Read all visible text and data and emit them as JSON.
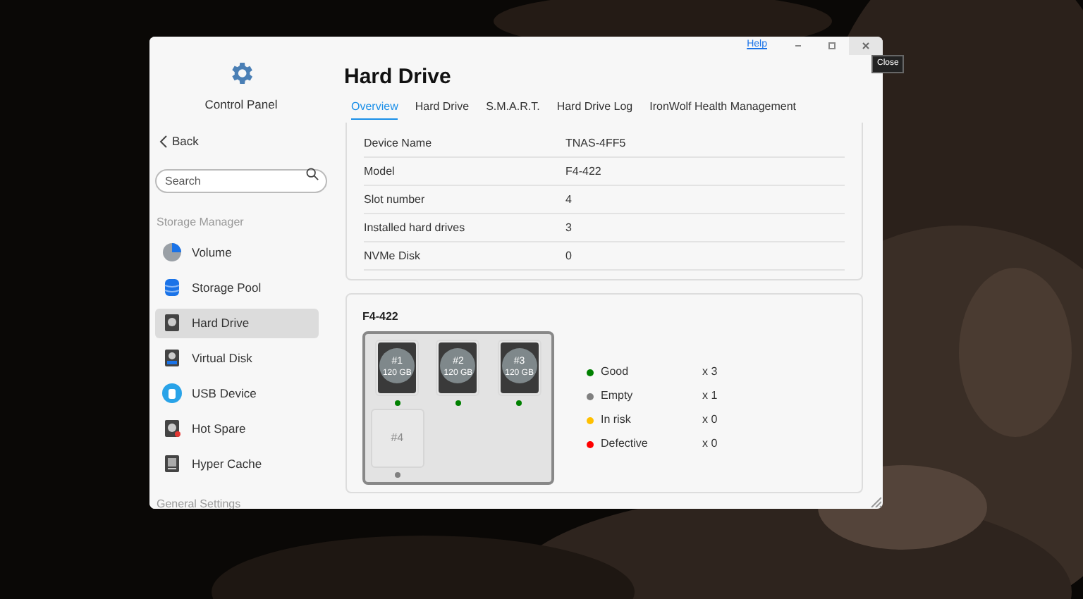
{
  "window": {
    "help": "Help",
    "tooltip": "Close"
  },
  "sidebar": {
    "title": "Control Panel",
    "back": "Back",
    "search": {
      "placeholder": "Search"
    },
    "sections": [
      {
        "heading": "Storage Manager",
        "items": [
          {
            "label": "Volume",
            "selected": false
          },
          {
            "label": "Storage Pool",
            "selected": false
          },
          {
            "label": "Hard Drive",
            "selected": true
          },
          {
            "label": "Virtual Disk",
            "selected": false
          },
          {
            "label": "USB Device",
            "selected": false
          },
          {
            "label": "Hot Spare",
            "selected": false
          },
          {
            "label": "Hyper Cache",
            "selected": false
          }
        ]
      },
      {
        "heading": "General Settings"
      }
    ]
  },
  "page": {
    "title": "Hard Drive",
    "tabs": [
      {
        "label": "Overview",
        "selected": true
      },
      {
        "label": "Hard Drive",
        "selected": false
      },
      {
        "label": "S.M.A.R.T.",
        "selected": false
      },
      {
        "label": "Hard Drive Log",
        "selected": false
      },
      {
        "label": "IronWolf Health Management",
        "selected": false
      }
    ],
    "info": [
      {
        "label": "Device Name",
        "value": "TNAS-4FF5"
      },
      {
        "label": "Model",
        "value": "F4-422"
      },
      {
        "label": "Slot number",
        "value": "4"
      },
      {
        "label": "Installed hard drives",
        "value": "3"
      },
      {
        "label": "NVMe Disk",
        "value": "0"
      }
    ],
    "enclosure": {
      "title": "F4-422",
      "slots": [
        {
          "kind": "drive",
          "label": "#1",
          "capacity": "120 GB",
          "color": "#008000"
        },
        {
          "kind": "drive",
          "label": "#2",
          "capacity": "120 GB",
          "color": "#008000"
        },
        {
          "kind": "drive",
          "label": "#3",
          "capacity": "120 GB",
          "color": "#008000"
        },
        {
          "kind": "empty",
          "label": "#4",
          "color": "#808080"
        }
      ],
      "legend": [
        {
          "label": "Good",
          "count": "x 3",
          "color": "#008000"
        },
        {
          "label": "Empty",
          "count": "x 1",
          "color": "#808080"
        },
        {
          "label": "In risk",
          "count": "x 0",
          "color": "#ffc000"
        },
        {
          "label": "Defective",
          "count": "x 0",
          "color": "#ff0000"
        }
      ]
    }
  }
}
